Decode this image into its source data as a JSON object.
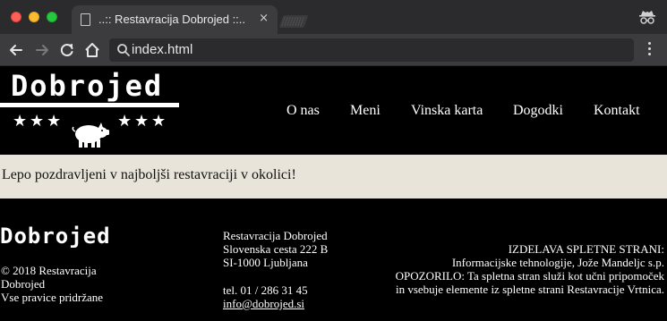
{
  "browser": {
    "tab_title": "..:: Restavracija Dobrojed ::..",
    "tab_close": "×",
    "address": "index.html",
    "colors": {
      "chrome_dark": "#2b2b2d",
      "chrome_light": "#3c3c3f"
    }
  },
  "header": {
    "logo_text": "Dobrojed",
    "star_glyph": "★",
    "nav": [
      "O nas",
      "Meni",
      "Vinska karta",
      "Dogodki",
      "Kontakt"
    ]
  },
  "welcome": {
    "text": "Lepo pozdravljeni v najboljši restavraciji v okolici!",
    "background": "#e8e4d9"
  },
  "footer": {
    "logo_text": "Dobrojed",
    "copyright": [
      "© 2018 Restavracija",
      "Dobrojed",
      "Vse pravice pridržane"
    ],
    "address": [
      "Restavracija Dobrojed",
      "Slovenska cesta 222 B",
      "SI-1000 Ljubljana"
    ],
    "phone": "tel. 01 / 286 31 45",
    "email": "info@dobrojed.si",
    "credits": [
      "IZDELAVA SPLETNE STRANI:",
      "Informacijske tehnologije, Jože Mandeljc s.p.",
      "OPOZORILO: Ta spletna stran služi kot učni pripomoček",
      "in vsebuje elemente iz spletne strani Restavracije Vrtnica."
    ]
  }
}
